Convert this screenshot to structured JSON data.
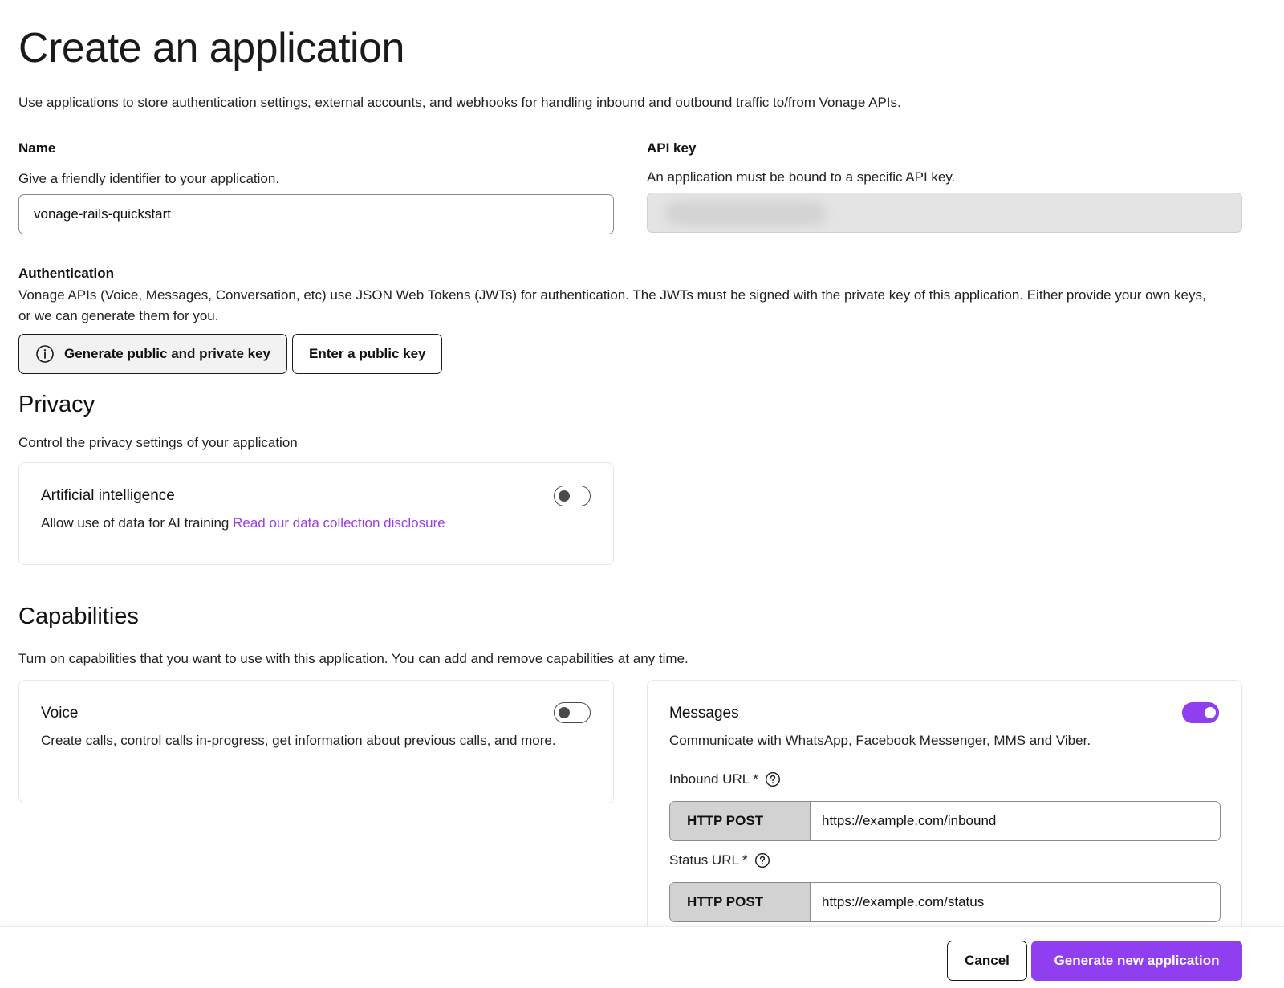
{
  "page": {
    "title": "Create an application",
    "intro": "Use applications to store authentication settings, external accounts, and webhooks for handling inbound and outbound traffic to/from Vonage APIs."
  },
  "name": {
    "label": "Name",
    "help": "Give a friendly identifier to your application.",
    "value": "vonage-rails-quickstart"
  },
  "api_key": {
    "label": "API key",
    "help": "An application must be bound to a specific API key."
  },
  "authentication": {
    "label": "Authentication",
    "help": "Vonage APIs (Voice, Messages, Conversation, etc) use JSON Web Tokens (JWTs) for authentication. The JWTs must be signed with the private key of this application. Either provide your own keys, or we can generate them for you.",
    "generate_button": "Generate public and private key",
    "enter_button": "Enter a public key"
  },
  "privacy": {
    "title": "Privacy",
    "help": "Control the privacy settings of your application",
    "ai": {
      "title": "Artificial intelligence",
      "desc": "Allow use of data for AI training",
      "link": "Read our data collection disclosure",
      "enabled": false
    }
  },
  "capabilities": {
    "title": "Capabilities",
    "help": "Turn on capabilities that you want to use with this application. You can add and remove capabilities at any time.",
    "voice": {
      "title": "Voice",
      "desc": "Create calls, control calls in-progress, get information about previous calls, and more.",
      "enabled": false
    },
    "messages": {
      "title": "Messages",
      "desc": "Communicate with WhatsApp, Facebook Messenger, MMS and Viber.",
      "enabled": true,
      "inbound_label": "Inbound URL *",
      "inbound_method": "HTTP POST",
      "inbound_url": "https://example.com/inbound",
      "status_label": "Status URL *",
      "status_method": "HTTP POST",
      "status_url": "https://example.com/status"
    }
  },
  "footer": {
    "cancel": "Cancel",
    "submit": "Generate new application"
  },
  "colors": {
    "accent": "#8f3ff0",
    "link": "#9b3fe0"
  },
  "icons": {
    "info": "info-icon",
    "help": "question-circle-icon"
  }
}
